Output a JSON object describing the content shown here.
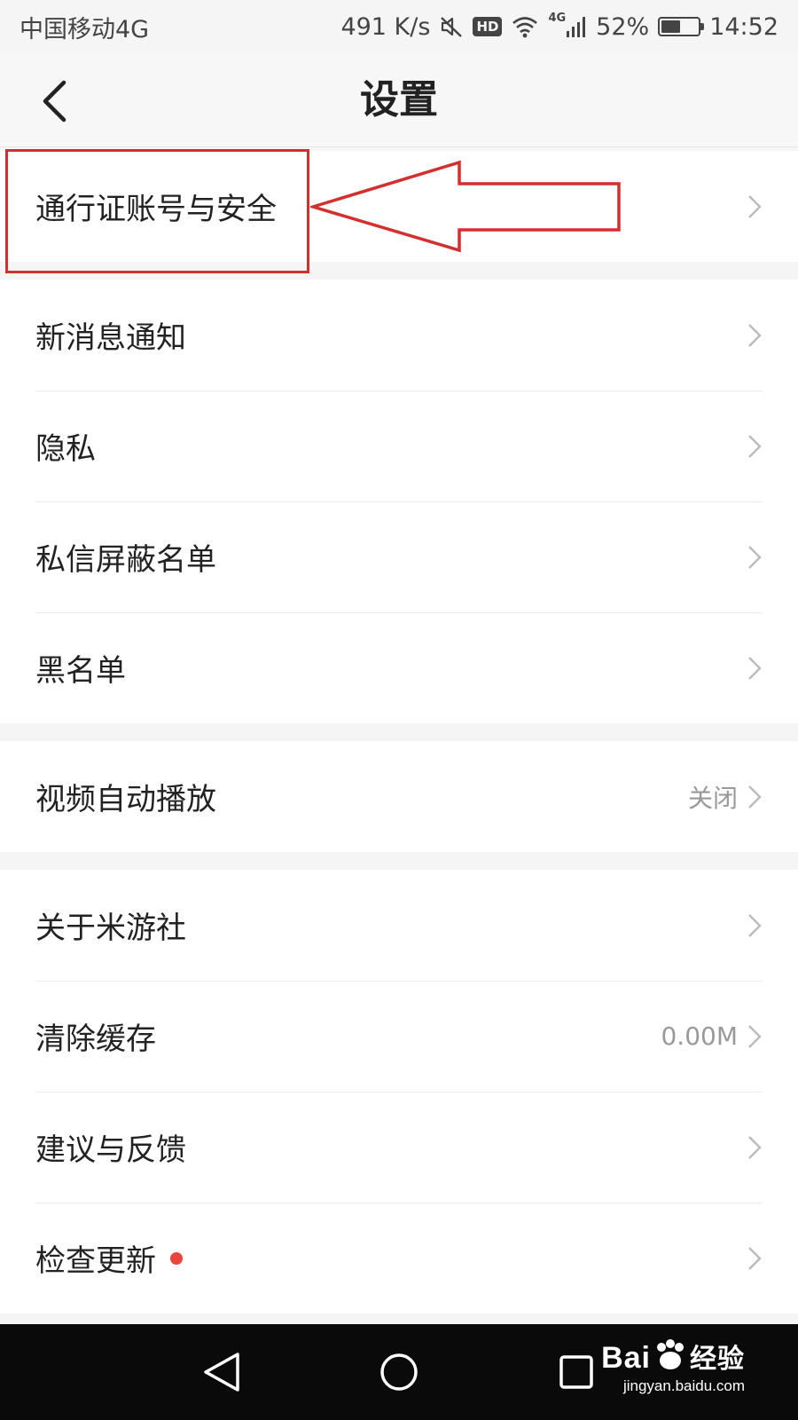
{
  "status_bar": {
    "carrier": "中国移动4G",
    "speed": "491 K/s",
    "hd": "HD",
    "network": "4G",
    "battery": "52%",
    "battery_level": 0.52,
    "time": "14:52"
  },
  "header": {
    "title": "设置"
  },
  "groups": [
    {
      "items": [
        {
          "label": "通行证账号与安全"
        }
      ]
    },
    {
      "items": [
        {
          "label": "新消息通知"
        },
        {
          "label": "隐私"
        },
        {
          "label": "私信屏蔽名单"
        },
        {
          "label": "黑名单"
        }
      ]
    },
    {
      "items": [
        {
          "label": "视频自动播放",
          "value": "关闭"
        }
      ]
    },
    {
      "items": [
        {
          "label": "关于米游社"
        },
        {
          "label": "清除缓存",
          "value": "0.00M"
        },
        {
          "label": "建议与反馈"
        },
        {
          "label": "检查更新",
          "badge": true
        }
      ]
    }
  ],
  "watermark": {
    "logo_left": "Bai",
    "logo_right": "经验",
    "url": "jingyan.baidu.com"
  },
  "colors": {
    "annotation": "#d32f2f",
    "badge": "#e8453c"
  }
}
